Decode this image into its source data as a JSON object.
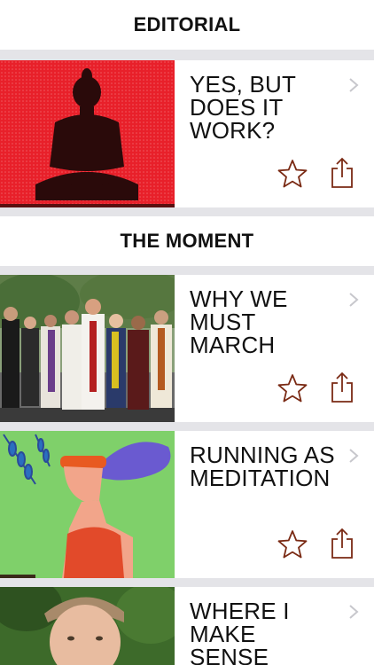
{
  "sections": [
    {
      "header": "EDITORIAL",
      "cards": [
        {
          "title": "YES, BUT DOES IT WORK?",
          "image": "buddha-statue-on-red"
        }
      ]
    },
    {
      "header": "THE MOMENT",
      "cards": [
        {
          "title": "WHY WE MUST MARCH",
          "image": "clergy-march-photo"
        },
        {
          "title": "RUNNING AS MEDITATION",
          "image": "runner-illustration-green"
        },
        {
          "title": "WHERE I MAKE SENSE",
          "image": "portrait-photo"
        }
      ]
    }
  ],
  "icons": {
    "chevron": "chevron-right-icon",
    "favorite": "star-outline-icon",
    "share": "share-icon"
  },
  "colors": {
    "accent": "#7a2a14",
    "separator": "#e4e4e8",
    "chevron": "#c7c7cc",
    "editorial_red": "#e8202a"
  }
}
